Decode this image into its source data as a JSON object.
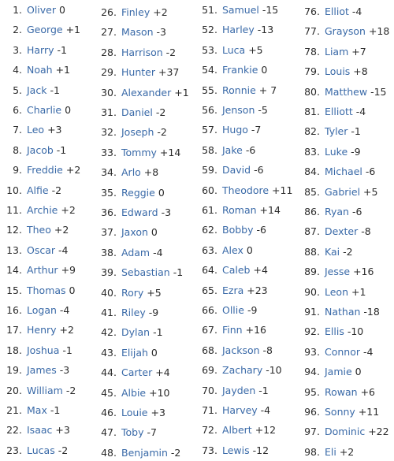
{
  "columns": [
    [
      {
        "num": "1.",
        "name": "Oliver",
        "change": "0"
      },
      {
        "num": "2.",
        "name": "George",
        "change": "+1"
      },
      {
        "num": "3.",
        "name": "Harry",
        "change": "-1"
      },
      {
        "num": "4.",
        "name": "Noah",
        "change": "+1"
      },
      {
        "num": "5.",
        "name": "Jack",
        "change": "-1"
      },
      {
        "num": "6.",
        "name": "Charlie",
        "change": "0"
      },
      {
        "num": "7.",
        "name": "Leo",
        "change": "+3"
      },
      {
        "num": "8.",
        "name": "Jacob",
        "change": "-1"
      },
      {
        "num": "9.",
        "name": "Freddie",
        "change": "+2"
      },
      {
        "num": "10.",
        "name": "Alfie",
        "change": "-2"
      },
      {
        "num": "11.",
        "name": "Archie",
        "change": "+2"
      },
      {
        "num": "12.",
        "name": "Theo",
        "change": "+2"
      },
      {
        "num": "13.",
        "name": "Oscar",
        "change": "-4"
      },
      {
        "num": "14.",
        "name": "Arthur",
        "change": "+9"
      },
      {
        "num": "15.",
        "name": "Thomas",
        "change": "0"
      },
      {
        "num": "16.",
        "name": "Logan",
        "change": "-4"
      },
      {
        "num": "17.",
        "name": "Henry",
        "change": "+2"
      },
      {
        "num": "18.",
        "name": "Joshua",
        "change": "-1"
      },
      {
        "num": "19.",
        "name": "James",
        "change": "-3"
      },
      {
        "num": "20.",
        "name": "William",
        "change": "-2"
      },
      {
        "num": "21.",
        "name": "Max",
        "change": "-1"
      },
      {
        "num": "22.",
        "name": "Isaac",
        "change": "+3"
      },
      {
        "num": "23.",
        "name": "Lucas",
        "change": "-2"
      }
    ],
    [
      {
        "num": "26.",
        "name": "Finley",
        "change": "+2"
      },
      {
        "num": "27.",
        "name": "Mason",
        "change": "-3"
      },
      {
        "num": "28.",
        "name": "Harrison",
        "change": "-2"
      },
      {
        "num": "29.",
        "name": "Hunter",
        "change": "+37"
      },
      {
        "num": "30.",
        "name": "Alexander",
        "change": "+1"
      },
      {
        "num": "31.",
        "name": "Daniel",
        "change": "-2"
      },
      {
        "num": "32.",
        "name": "Joseph",
        "change": "-2"
      },
      {
        "num": "33.",
        "name": "Tommy",
        "change": "+14"
      },
      {
        "num": "34.",
        "name": "Arlo",
        "change": "+8"
      },
      {
        "num": "35.",
        "name": "Reggie",
        "change": "0"
      },
      {
        "num": "36.",
        "name": "Edward",
        "change": "-3"
      },
      {
        "num": "37.",
        "name": "Jaxon",
        "change": "0"
      },
      {
        "num": "38.",
        "name": "Adam",
        "change": "-4"
      },
      {
        "num": "39.",
        "name": "Sebastian",
        "change": "-1"
      },
      {
        "num": "40.",
        "name": "Rory",
        "change": "+5"
      },
      {
        "num": "41.",
        "name": "Riley",
        "change": "-9"
      },
      {
        "num": "42.",
        "name": "Dylan",
        "change": "-1"
      },
      {
        "num": "43.",
        "name": "Elijah",
        "change": "0"
      },
      {
        "num": "44.",
        "name": "Carter",
        "change": "+4"
      },
      {
        "num": "45.",
        "name": "Albie",
        "change": "+10"
      },
      {
        "num": "46.",
        "name": "Louie",
        "change": "+3"
      },
      {
        "num": "47.",
        "name": "Toby",
        "change": "-7"
      },
      {
        "num": "48.",
        "name": "Benjamin",
        "change": "-2"
      }
    ],
    [
      {
        "num": "51.",
        "name": "Samuel",
        "change": "-15"
      },
      {
        "num": "52.",
        "name": "Harley",
        "change": "-13"
      },
      {
        "num": "53.",
        "name": "Luca",
        "change": "+5"
      },
      {
        "num": "54.",
        "name": "Frankie",
        "change": "0"
      },
      {
        "num": "55.",
        "name": "Ronnie",
        "change": "+ 7"
      },
      {
        "num": "56.",
        "name": "Jenson",
        "change": "-5"
      },
      {
        "num": "57.",
        "name": "Hugo",
        "change": "-7"
      },
      {
        "num": "58.",
        "name": "Jake",
        "change": "-6"
      },
      {
        "num": "59.",
        "name": "David",
        "change": "-6"
      },
      {
        "num": "60.",
        "name": "Theodore",
        "change": "+11"
      },
      {
        "num": "61.",
        "name": "Roman",
        "change": "+14"
      },
      {
        "num": "62.",
        "name": "Bobby",
        "change": "-6"
      },
      {
        "num": "63.",
        "name": "Alex",
        "change": "0"
      },
      {
        "num": "64.",
        "name": "Caleb",
        "change": "+4"
      },
      {
        "num": "65.",
        "name": "Ezra",
        "change": "+23"
      },
      {
        "num": "66.",
        "name": "Ollie",
        "change": "-9"
      },
      {
        "num": "67.",
        "name": "Finn",
        "change": "+16"
      },
      {
        "num": "68.",
        "name": "Jackson",
        "change": "-8"
      },
      {
        "num": "69.",
        "name": "Zachary",
        "change": "-10"
      },
      {
        "num": "70.",
        "name": "Jayden",
        "change": "-1"
      },
      {
        "num": "71.",
        "name": "Harvey",
        "change": "-4"
      },
      {
        "num": "72.",
        "name": "Albert",
        "change": "+12"
      },
      {
        "num": "73.",
        "name": "Lewis",
        "change": "-12"
      }
    ],
    [
      {
        "num": "76.",
        "name": "Elliot",
        "change": "-4"
      },
      {
        "num": "77.",
        "name": "Grayson",
        "change": "+18"
      },
      {
        "num": "78.",
        "name": "Liam",
        "change": "+7"
      },
      {
        "num": "79.",
        "name": "Louis",
        "change": "+8"
      },
      {
        "num": "80.",
        "name": "Matthew",
        "change": "-15"
      },
      {
        "num": "81.",
        "name": "Elliott",
        "change": "-4"
      },
      {
        "num": "82.",
        "name": "Tyler",
        "change": "-1"
      },
      {
        "num": "83.",
        "name": "Luke",
        "change": "-9"
      },
      {
        "num": "84.",
        "name": "Michael",
        "change": "-6"
      },
      {
        "num": "85.",
        "name": "Gabriel",
        "change": "+5"
      },
      {
        "num": "86.",
        "name": "Ryan",
        "change": "-6"
      },
      {
        "num": "87.",
        "name": "Dexter",
        "change": "-8"
      },
      {
        "num": "88.",
        "name": "Kai",
        "change": "-2"
      },
      {
        "num": "89.",
        "name": "Jesse",
        "change": "+16"
      },
      {
        "num": "90.",
        "name": "Leon",
        "change": "+1"
      },
      {
        "num": "91.",
        "name": "Nathan",
        "change": "-18"
      },
      {
        "num": "92.",
        "name": "Ellis",
        "change": "-10"
      },
      {
        "num": "93.",
        "name": "Connor",
        "change": "-4"
      },
      {
        "num": "94.",
        "name": "Jamie",
        "change": "0"
      },
      {
        "num": "95.",
        "name": "Rowan",
        "change": "+6"
      },
      {
        "num": "96.",
        "name": "Sonny",
        "change": "+11"
      },
      {
        "num": "97.",
        "name": "Dominic",
        "change": "+22"
      },
      {
        "num": "98.",
        "name": "Eli",
        "change": "+2"
      }
    ]
  ]
}
